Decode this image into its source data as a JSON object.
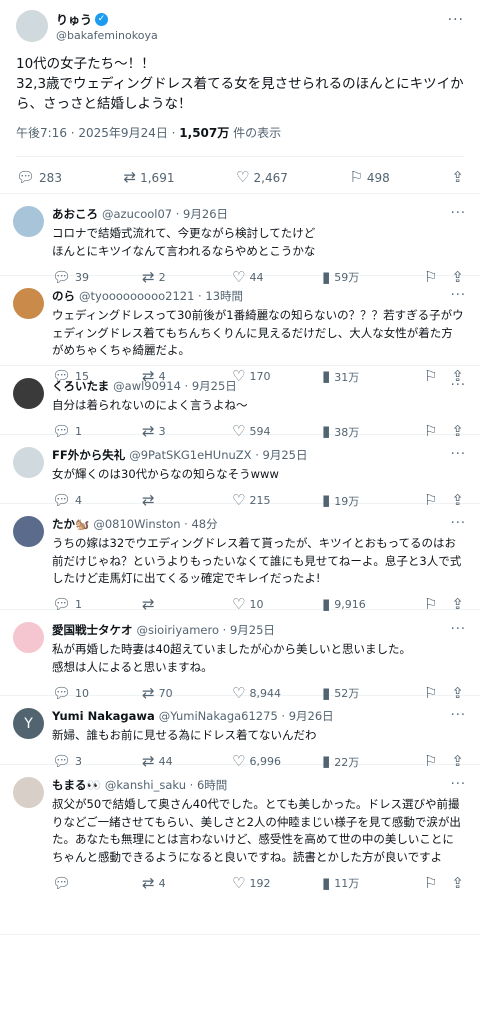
{
  "post": {
    "name": "りゅう",
    "handle": "@bakafeminokoya",
    "text": "10代の女子たち〜！！\n32,3歳でウェディングドレス着てる女を見させられるのほんとにキツイから、さっさと結婚しような！",
    "time": "午後7:16 · 2025年9月24日 · ",
    "views": "1,507万",
    "views_label": " 件の表示",
    "replies": "283",
    "reposts": "1,691",
    "likes": "2,467",
    "bookmarks": "498"
  },
  "replies": [
    {
      "name": "あおころ",
      "handle": "@azucool07 · 9月26日",
      "text": "コロナで結婚式流れて、今更ながら検討してたけど\nほんとにキツイなんて言われるならやめとこうかな",
      "replies": "39",
      "reposts": "2",
      "likes": "44",
      "views": "59万",
      "avatar_color": "#a8c4d8"
    },
    {
      "name": "のら",
      "handle": "@tyooooooooo2121 · 13時間",
      "text": "ウェディングドレスって30前後が1番綺麗なの知らないの？？？若すぎる子がウェディングドレス着てもちんちくりんに見えるだけだし、大人な女性が着た方がめちゃくちゃ綺麗だよ。",
      "replies": "15",
      "reposts": "4",
      "likes": "170",
      "views": "31万",
      "avatar_color": "#c98a4a"
    },
    {
      "name": "くろいたま",
      "handle": "@awl90914 · 9月25日",
      "text": "自分は着られないのによく言うよね〜",
      "replies": "1",
      "reposts": "3",
      "likes": "594",
      "views": "38万",
      "avatar_color": "#3a3a3a"
    },
    {
      "name": "FF外から失礼",
      "handle": "@9PatSKG1eHUnuZX · 9月25日",
      "text": "女が輝くのは30代からなの知らなそうwww",
      "replies": "4",
      "reposts": "",
      "likes": "215",
      "views": "19万",
      "avatar_color": "#cfd9de"
    },
    {
      "name": "たか🐿️",
      "handle": "@0810Winston · 48分",
      "text": "うちの嫁は32でウエディングドレス着て貰ったが、キツイとおもってるのはお前だけじゃね？というよりもったいなくて誰にも見せてねーよ。息子と3人で式したけど走馬灯に出てくるッ確定でキレイだったよ!",
      "replies": "1",
      "reposts": "",
      "likes": "10",
      "views": "9,916",
      "avatar_color": "#5a6b8c"
    },
    {
      "name": "愛国戦士タケオ",
      "handle": "@sioiriyamero · 9月25日",
      "text": "私が再婚した時妻は40超えていましたが心から美しいと思いました。\n感想は人によると思いますね。",
      "replies": "10",
      "reposts": "70",
      "likes": "8,944",
      "views": "52万",
      "avatar_color": "#f5c6d0"
    },
    {
      "name": "Yumi Nakagawa",
      "handle": "@YumiNakaga61275 · 9月26日",
      "text": "新婦、誰もお前に見せる為にドレス着てないんだわ",
      "replies": "3",
      "reposts": "44",
      "likes": "6,996",
      "views": "22万",
      "avatar_color": "#536471",
      "avatar_letter": "Y"
    },
    {
      "name": "もまる👀",
      "handle": "@kanshi_saku · 6時間",
      "text": "叔父が50で結婚して奥さん40代でした。とても美しかった。ドレス選びや前撮りなどご一緒させてもらい、美しさと2人の仲睦まじい様子を見て感動で涙が出た。あなたも無理にとは言わないけど、感受性を高めて世の中の美しいことにちゃんと感動できるようになると良いですね。読書とかした方が良いですよ",
      "replies": "",
      "reposts": "4",
      "likes": "192",
      "views": "11万",
      "avatar_color": "#d8cfc8"
    }
  ],
  "icons": {
    "reply": "reply-icon",
    "repost": "repost-icon",
    "like": "heart-icon",
    "views": "views-icon",
    "bookmark": "bookmark-icon",
    "share": "share-icon"
  }
}
